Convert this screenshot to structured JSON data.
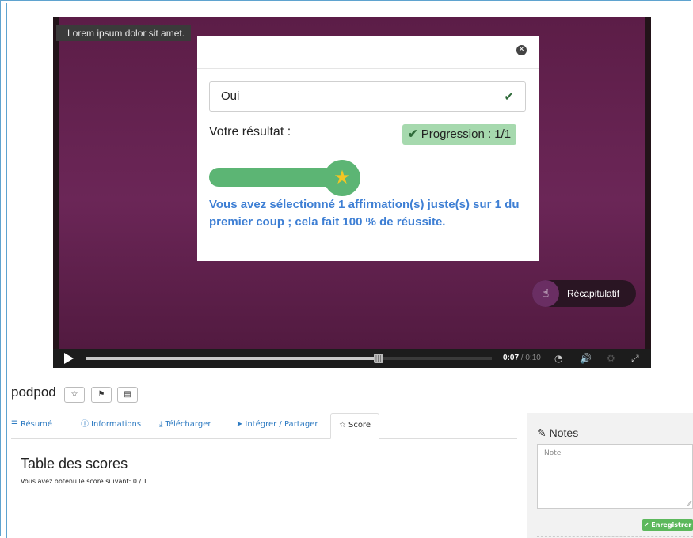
{
  "player": {
    "overlay_text": "Lorem ipsum dolor sit amet.",
    "recap_label": "Récapitulatif",
    "time_current": "0:07",
    "time_duration": "/ 0:10",
    "progress_fraction": 0.72
  },
  "modal": {
    "answer": "Oui",
    "result_label": "Votre résultat :",
    "progress_badge": "Progression : 1/1",
    "feedback": "Vous avez sélectionné 1 affirmation(s) juste(s) sur 1 du premier coup ; cela fait 100 % de réussite."
  },
  "page": {
    "title": "podpod"
  },
  "tabs": [
    {
      "icon": "list-icon",
      "label": "Résumé"
    },
    {
      "icon": "info-icon",
      "label": "Informations"
    },
    {
      "icon": "download-icon",
      "label": "Télécharger"
    },
    {
      "icon": "share-icon",
      "label": "Intégrer / Partager"
    },
    {
      "icon": "star-icon",
      "label": "Score"
    }
  ],
  "scores": {
    "heading": "Table des scores",
    "text": "Vous avez obtenu le score suivant: 0 / 1"
  },
  "notes": {
    "title": "Notes",
    "placeholder": "Note",
    "save_label": "Enregistrer"
  },
  "colors": {
    "player_bg": "#5e1f4a",
    "success": "#5cb574",
    "feedback": "#3e7fd4",
    "link": "#2e7bc2"
  }
}
